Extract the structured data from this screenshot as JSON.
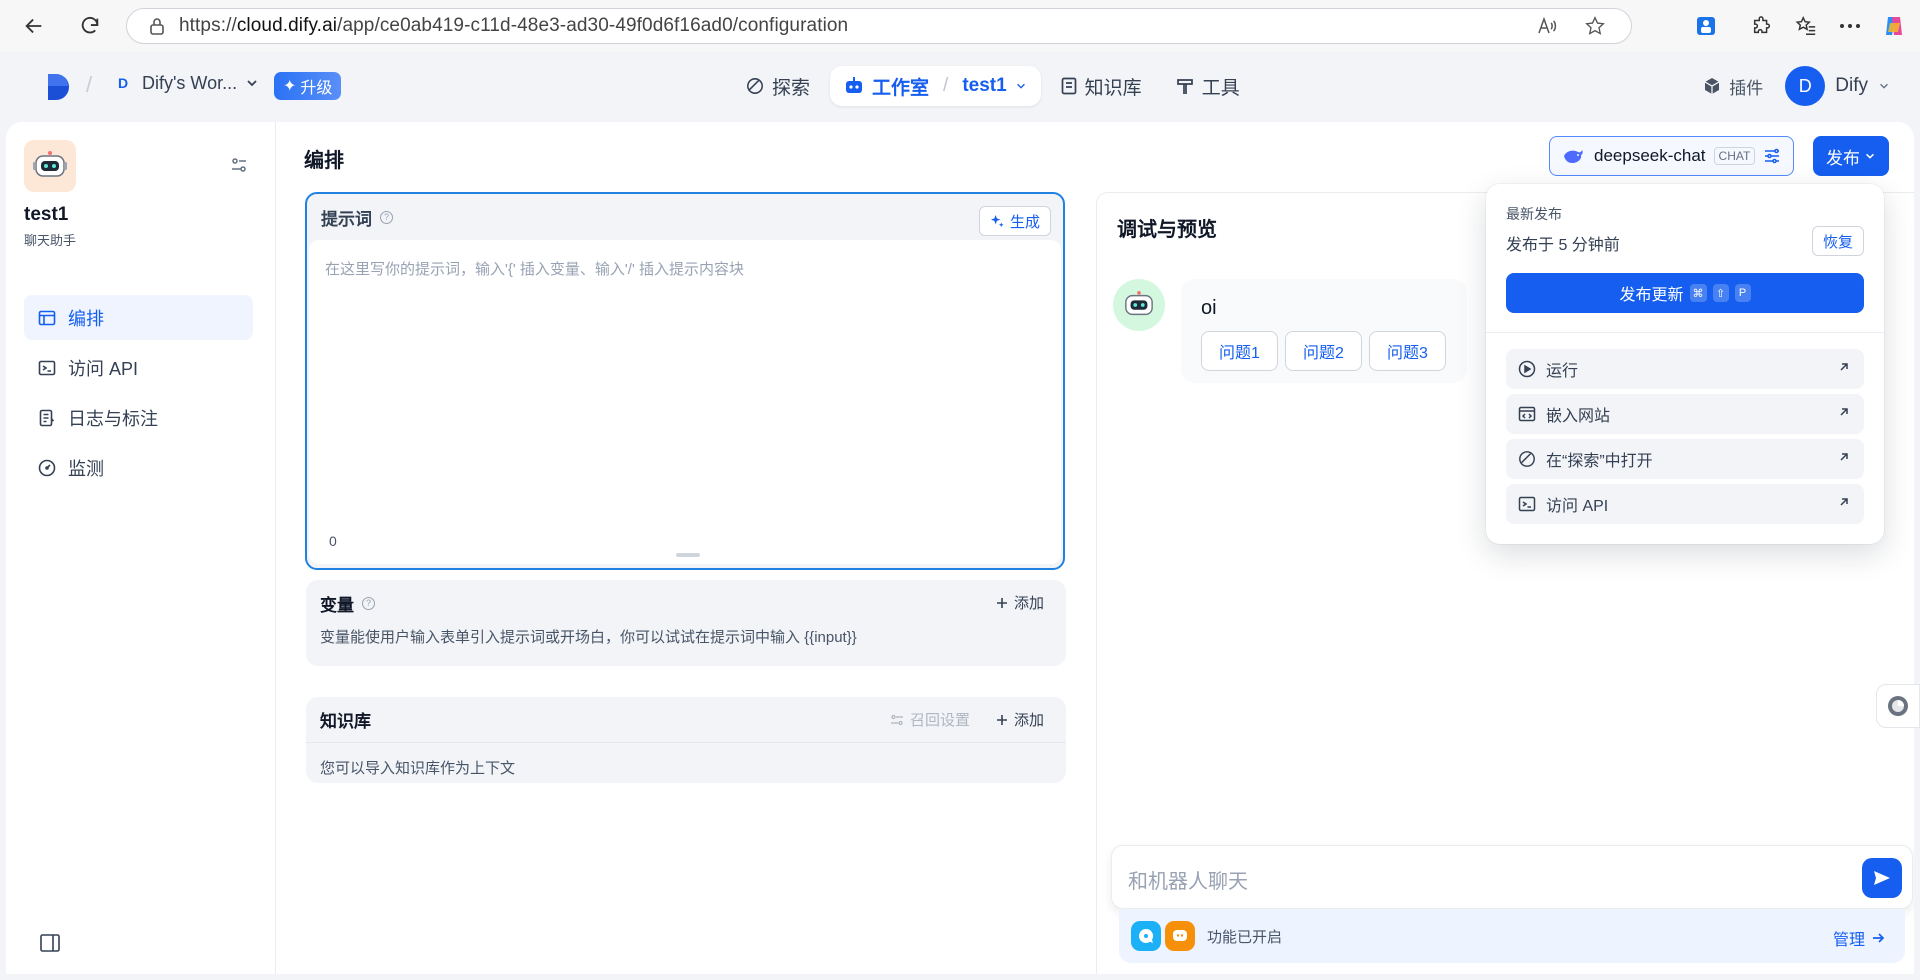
{
  "browser": {
    "url_prefix": "https://",
    "url_host": "cloud.dify.ai",
    "url_path": "/app/ce0ab419-c11d-48e3-ad30-49f0d6f16ad0/configuration"
  },
  "header": {
    "workspace_initial": "D",
    "workspace_name": "Dify's Wor...",
    "upgrade_label": "升级",
    "nav": {
      "explore": "探索",
      "studio": "工作室",
      "app": "test1",
      "knowledge": "知识库",
      "tools": "工具"
    },
    "plugins_label": "插件",
    "user_initial": "D",
    "user_name": "Dify"
  },
  "sidebar": {
    "app_name": "test1",
    "app_type": "聊天助手",
    "items": [
      {
        "label": "编排",
        "icon": "layout-icon",
        "active": true
      },
      {
        "label": "访问 API",
        "icon": "terminal-icon",
        "active": false
      },
      {
        "label": "日志与标注",
        "icon": "document-icon",
        "active": false
      },
      {
        "label": "监测",
        "icon": "gauge-icon",
        "active": false
      }
    ]
  },
  "main": {
    "title": "编排",
    "model_name": "deepseek-chat",
    "model_tag": "CHAT",
    "publish_label": "发布",
    "prompt": {
      "title": "提示词",
      "generate_label": "生成",
      "placeholder": "在这里写你的提示词，输入'{' 插入变量、输入'/' 插入提示内容块",
      "char_count": "0"
    },
    "variables": {
      "title": "变量",
      "add_label": "添加",
      "description": "变量能使用户输入表单引入提示词或开场白，你可以试试在提示词中输入 {{input}}"
    },
    "knowledge": {
      "title": "知识库",
      "retrieval_label": "召回设置",
      "add_label": "添加",
      "description": "您可以导入知识库作为上下文"
    }
  },
  "debug": {
    "title": "调试与预览",
    "bot_message": "oi",
    "suggestions": [
      "问题1",
      "问题2",
      "问题3"
    ],
    "chat_placeholder": "和机器人聊天",
    "features_text": "功能已开启",
    "manage_label": "管理"
  },
  "publish_menu": {
    "latest_label": "最新发布",
    "published_time": "发布于 5 分钟前",
    "restore_label": "恢复",
    "update_label": "发布更新",
    "shortcut_keys": [
      "⌘",
      "⇧",
      "P"
    ],
    "items": [
      {
        "label": "运行",
        "icon": "play-icon"
      },
      {
        "label": "嵌入网站",
        "icon": "embed-icon"
      },
      {
        "label": "在“探索”中打开",
        "icon": "compass-icon"
      },
      {
        "label": "访问 API",
        "icon": "terminal-icon"
      }
    ]
  },
  "colors": {
    "primary": "#155eef",
    "prompt_border": "#1f82e0"
  }
}
